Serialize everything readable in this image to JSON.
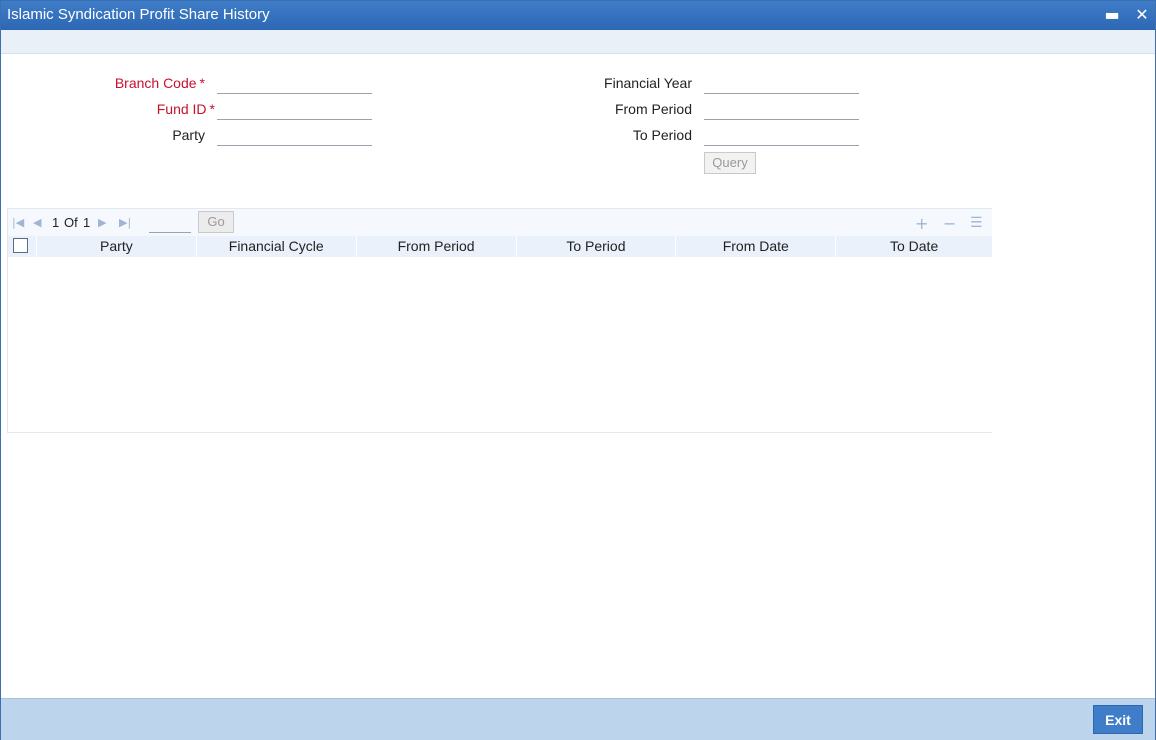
{
  "window": {
    "title": "Islamic Syndication Profit Share History",
    "minimize_glyph": "▬",
    "close_glyph": "✕"
  },
  "form": {
    "branch_code": {
      "label": "Branch Code",
      "required_mark": "*",
      "value": ""
    },
    "fund_id": {
      "label": "Fund ID",
      "required_mark": "*",
      "value": ""
    },
    "party": {
      "label": "Party",
      "value": ""
    },
    "financial_year": {
      "label": "Financial Year",
      "value": ""
    },
    "from_period": {
      "label": "From Period",
      "value": ""
    },
    "to_period": {
      "label": "To Period",
      "value": ""
    },
    "query_label": "Query"
  },
  "grid": {
    "pager": {
      "current": "1",
      "of_label": "Of",
      "total": "1",
      "go_label": "Go"
    },
    "icons": {
      "first": "first-page-icon",
      "prev": "prev-page-icon",
      "next": "next-page-icon",
      "last": "last-page-icon",
      "add": "add-row-icon",
      "delete": "delete-row-icon",
      "view": "single-view-icon"
    },
    "columns": [
      "Party",
      "Financial Cycle",
      "From Period",
      "To Period",
      "From Date",
      "To Date"
    ],
    "rows": []
  },
  "footer": {
    "exit_label": "Exit"
  },
  "colors": {
    "accent": "#3f7dc8",
    "required": "#c8102e",
    "footer": "#bcd5ec"
  }
}
